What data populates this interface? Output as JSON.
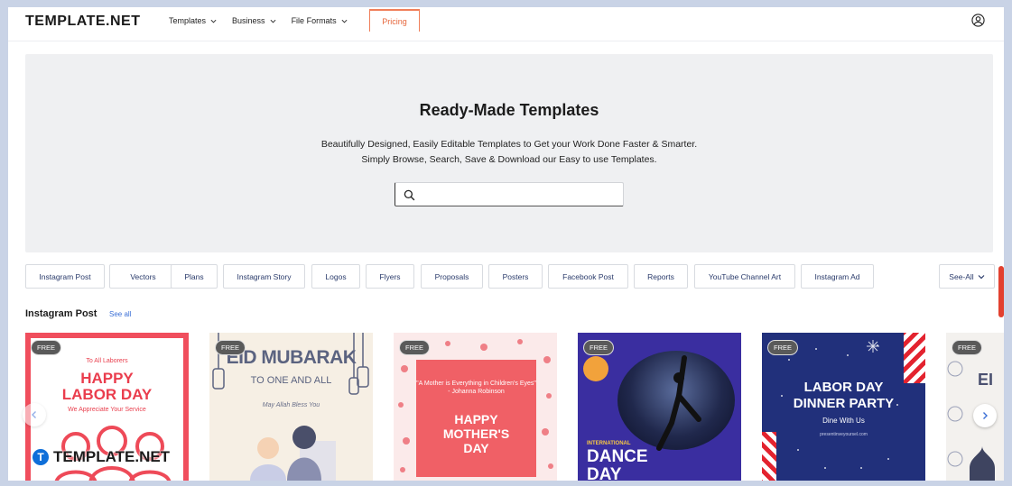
{
  "header": {
    "logo": "TEMPLATE.NET",
    "nav": [
      "Templates",
      "Business",
      "File Formats"
    ],
    "pricing": "Pricing"
  },
  "hero": {
    "title": "Ready-Made Templates",
    "subtitle_line1": "Beautifully Designed, Easily Editable Templates to Get your Work Done Faster & Smarter.",
    "subtitle_line2": "Simply Browse, Search, Save & Download our Easy to use Templates.",
    "search_placeholder": ""
  },
  "categories": [
    "Instagram Post",
    "Vectors",
    "Plans",
    "Instagram Story",
    "Logos",
    "Flyers",
    "Proposals",
    "Posters",
    "Facebook Post",
    "Reports",
    "YouTube Channel Art",
    "Instagram Ad"
  ],
  "see_all_btn": "See-All",
  "section": {
    "title": "Instagram Post",
    "link": "See all"
  },
  "cards": [
    {
      "badge": "FREE",
      "line1": "To All Laborers",
      "line2": "HAPPY LABOR DAY",
      "line3": "We Appreciate Your Service"
    },
    {
      "badge": "FREE",
      "line1": "EID MUBARAK",
      "line2": "TO ONE AND ALL",
      "line3": "May Allah Bless You"
    },
    {
      "badge": "FREE",
      "line1": "\"A Mother is Everything in Children's Eyes\" - Johanna Robinson",
      "line2": "HAPPY MOTHER'S DAY"
    },
    {
      "badge": "FREE",
      "line1": "INTERNATIONAL",
      "line2": "DANCE DAY"
    },
    {
      "badge": "FREE",
      "line1": "LABOR DAY DINNER PARTY",
      "line2": "Dine With Us",
      "line3": "presentinveyoursel.com"
    },
    {
      "badge": "FREE",
      "line1": "EI"
    }
  ],
  "watermark": {
    "mark": "T",
    "text": "TEMPLATE.NET"
  },
  "icons": {
    "search": "search-icon",
    "user": "user-circle-icon",
    "chevron": "chevron-down-icon",
    "prev": "chevron-left-icon",
    "next": "chevron-right-icon"
  },
  "colors": {
    "accent": "#e6673c",
    "link": "#3b6fd6",
    "chip_text": "#2a3b6b",
    "scroll_indicator": "#e2402f"
  }
}
